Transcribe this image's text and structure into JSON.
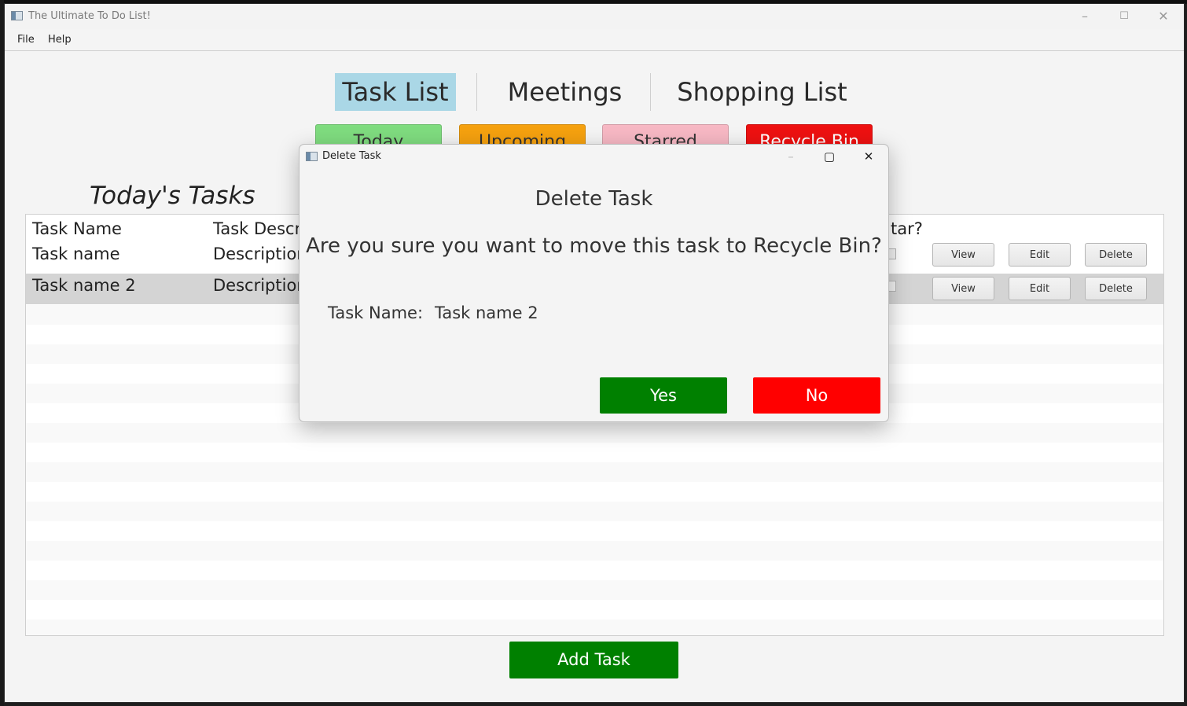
{
  "window": {
    "title": "The Ultimate To Do List!",
    "controls": {
      "minimize": "–",
      "maximize": "☐",
      "close": "✕"
    }
  },
  "menu": {
    "file": "File",
    "help": "Help"
  },
  "tabs": [
    {
      "label": "Task List",
      "active": true
    },
    {
      "label": "Meetings",
      "active": false
    },
    {
      "label": "Shopping List",
      "active": false
    }
  ],
  "subtabs": [
    {
      "label": "Today",
      "color": "#7fdc7f"
    },
    {
      "label": "Upcoming",
      "color": "#f5a10f"
    },
    {
      "label": "Starred",
      "color": "#f7b8c4"
    },
    {
      "label": "Recycle Bin",
      "color": "#ee1111"
    }
  ],
  "page_heading": "Today's Tasks",
  "table": {
    "headers": {
      "name": "Task Name",
      "description": "Task Descr",
      "star": "tar?"
    },
    "rows": [
      {
        "name": "Task name",
        "description": "Description",
        "selected": false
      },
      {
        "name": "Task name 2",
        "description": "Description",
        "selected": true
      }
    ],
    "actions": {
      "view": "View",
      "edit": "Edit",
      "delete": "Delete"
    }
  },
  "add_task_label": "Add Task",
  "dialog": {
    "title": "Delete Task",
    "controls": {
      "minimize": "–",
      "maximize": "▢",
      "close": "✕"
    },
    "heading": "Delete Task",
    "question": "Are you sure you want to move this task to Recycle Bin?",
    "task_name_label": "Task Name:",
    "task_name_value": "Task name 2",
    "yes_label": "Yes",
    "no_label": "No"
  },
  "colors": {
    "accent_green": "#008000",
    "danger_red": "#ff0000",
    "tab_active": "#aad7e6",
    "row_selected": "#d4d4d4"
  }
}
